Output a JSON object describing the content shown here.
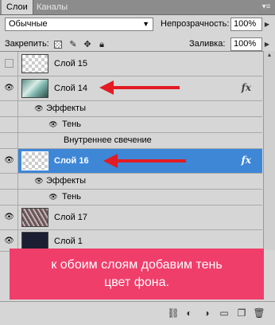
{
  "tabs": [
    "Слои",
    "Каналы"
  ],
  "tab_menu_icon": "panel-menu-icon",
  "blend_mode": "Обычные",
  "opacity_label": "Непрозрачность:",
  "opacity_value": "100%",
  "lock_label": "Закрепить:",
  "fill_label": "Заливка:",
  "fill_value": "100%",
  "layers": [
    {
      "name": "Слой 15",
      "visible": false,
      "fx": false
    },
    {
      "name": "Слой 14",
      "visible": true,
      "fx": true,
      "fx_label": "fx",
      "effects_label": "Эффекты",
      "effects": [
        "Тень",
        "Внутреннее свечение"
      ]
    },
    {
      "name": "Слой 16",
      "visible": true,
      "fx": true,
      "fx_label": "fx",
      "selected": true,
      "effects_label": "Эффекты",
      "effects": [
        "Тень"
      ]
    },
    {
      "name": "Слой 17",
      "visible": true,
      "fx": false
    },
    {
      "name": "Слой 1",
      "visible": true,
      "fx": false
    }
  ],
  "annotation": {
    "line1": "к обоим слоям добавим тень",
    "line2": "цвет фона."
  },
  "colors": {
    "selection": "#3e87d6",
    "arrow": "#e31b23",
    "banner": "#f03e6b"
  }
}
